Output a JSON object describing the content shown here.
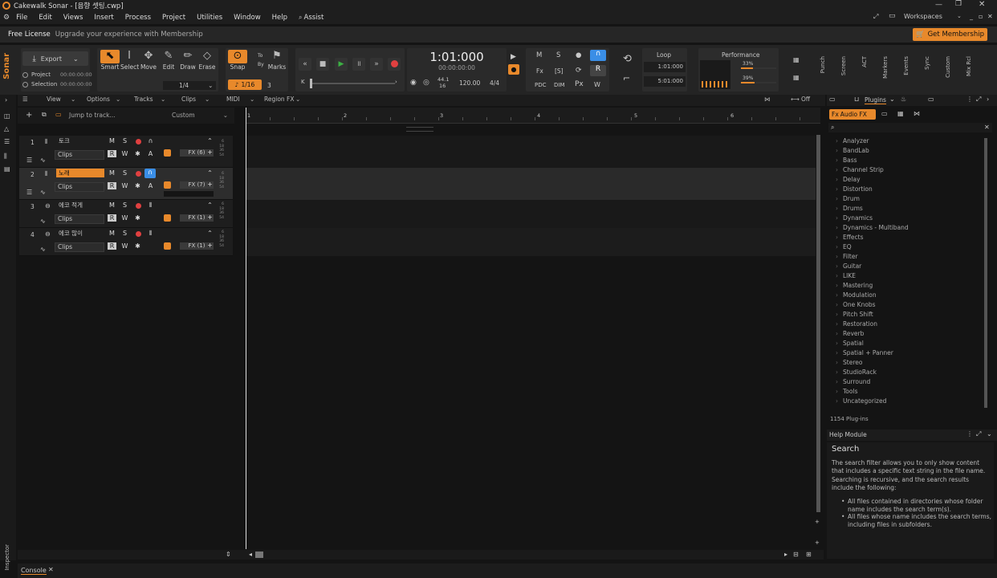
{
  "window": {
    "title": "Cakewalk Sonar - [음향 셋팅.cwp]"
  },
  "menu": [
    "File",
    "Edit",
    "Views",
    "Insert",
    "Process",
    "Project",
    "Utilities",
    "Window",
    "Help",
    "Assist"
  ],
  "workspaces": "Workspaces",
  "license": {
    "label": "Free License",
    "upgrade": "Upgrade your experience with Membership",
    "cta": "Get Membership"
  },
  "brand": "Sonar",
  "export": {
    "label": "Export",
    "project": "Project",
    "selection": "Selection",
    "project_time": "00:00:00:00",
    "selection_time": "00:00:00:00"
  },
  "tools": {
    "smart": "Smart",
    "select": "Select",
    "move": "Move",
    "edit": "Edit",
    "draw": "Draw",
    "erase": "Erase",
    "fraction": "1/4"
  },
  "snap": {
    "label": "Snap",
    "to": "To",
    "by": "By",
    "marks": "Marks",
    "value": "1/16",
    "count": "3"
  },
  "time": {
    "main": "1:01:000",
    "sub": "00:00:00:00",
    "rate": "44.1",
    "bits": "16",
    "tempo": "120.00",
    "meter": "4/4"
  },
  "mix": {
    "m": "M",
    "s": "S",
    "fx": "Fx",
    "sel": "[S]",
    "r": "R",
    "pdc": "PDC",
    "dim": "DIM",
    "px": "Px"
  },
  "loop": {
    "label": "Loop",
    "start": "1:01:000",
    "end": "5:01:000"
  },
  "performance": {
    "label": "Performance",
    "cpu": "33%",
    "disk": "39%",
    "cpu_level": 0.33,
    "disk_level": 0.39
  },
  "side_tabs": [
    "Punch",
    "Screen",
    "ACT",
    "Markers",
    "Events",
    "Sync",
    "Custom",
    "Mix Rcl"
  ],
  "viewbar": {
    "view": "View",
    "options": "Options",
    "tracks": "Tracks",
    "clips": "Clips",
    "midi": "MIDI",
    "regionfx": "Region FX",
    "off": "Off"
  },
  "trackbar": {
    "jump": "Jump to track...",
    "custom": "Custom"
  },
  "ruler": [
    "1",
    "2",
    "3",
    "4",
    "5",
    "6"
  ],
  "tracks": [
    {
      "num": "1",
      "name": "토크",
      "clips": "Clips",
      "fx": "FX (6)",
      "selected": false,
      "monitor": false
    },
    {
      "num": "2",
      "name": "노래",
      "clips": "Clips",
      "fx": "FX (7)",
      "selected": true,
      "monitor": true
    },
    {
      "num": "3",
      "name": "에코 적게",
      "clips": "Clips",
      "fx": "FX (1)",
      "selected": false,
      "monitor": false
    },
    {
      "num": "4",
      "name": "에코 많이",
      "clips": "Clips",
      "fx": "FX (1)",
      "selected": false,
      "monitor": false
    }
  ],
  "meter_ticks": [
    "6",
    "18",
    "36",
    "54"
  ],
  "browser": {
    "tab": "Plugins",
    "category": "Audio FX",
    "count": "1154 Plug-ins",
    "items": [
      "Analyzer",
      "BandLab",
      "Bass",
      "Channel Strip",
      "Delay",
      "Distortion",
      "Drum",
      "Drums",
      "Dynamics",
      "Dynamics - Multiband",
      "Effects",
      "EQ",
      "Filter",
      "Guitar",
      "LIKE",
      "Mastering",
      "Modulation",
      "One Knobs",
      "Pitch Shift",
      "Restoration",
      "Reverb",
      "Spatial",
      "Spatial + Panner",
      "Stereo",
      "StudioRack",
      "Surround",
      "Tools",
      "Uncategorized"
    ]
  },
  "help": {
    "title": "Help Module",
    "heading": "Search",
    "p1": "The search filter allows you to only show content that includes a specific text string in the file name.",
    "p2": "Searching is recursive, and the search results include the following:",
    "b1": "All files contained in directories whose folder name includes the search term(s).",
    "b2": "All files whose name includes the search terms, including files in subfolders."
  },
  "console": "Console",
  "inspector": "Inspector",
  "colors": {
    "accent": "#e8892b",
    "monitor": "#3a8ee6",
    "record": "#e04040",
    "play": "#3cb043"
  }
}
